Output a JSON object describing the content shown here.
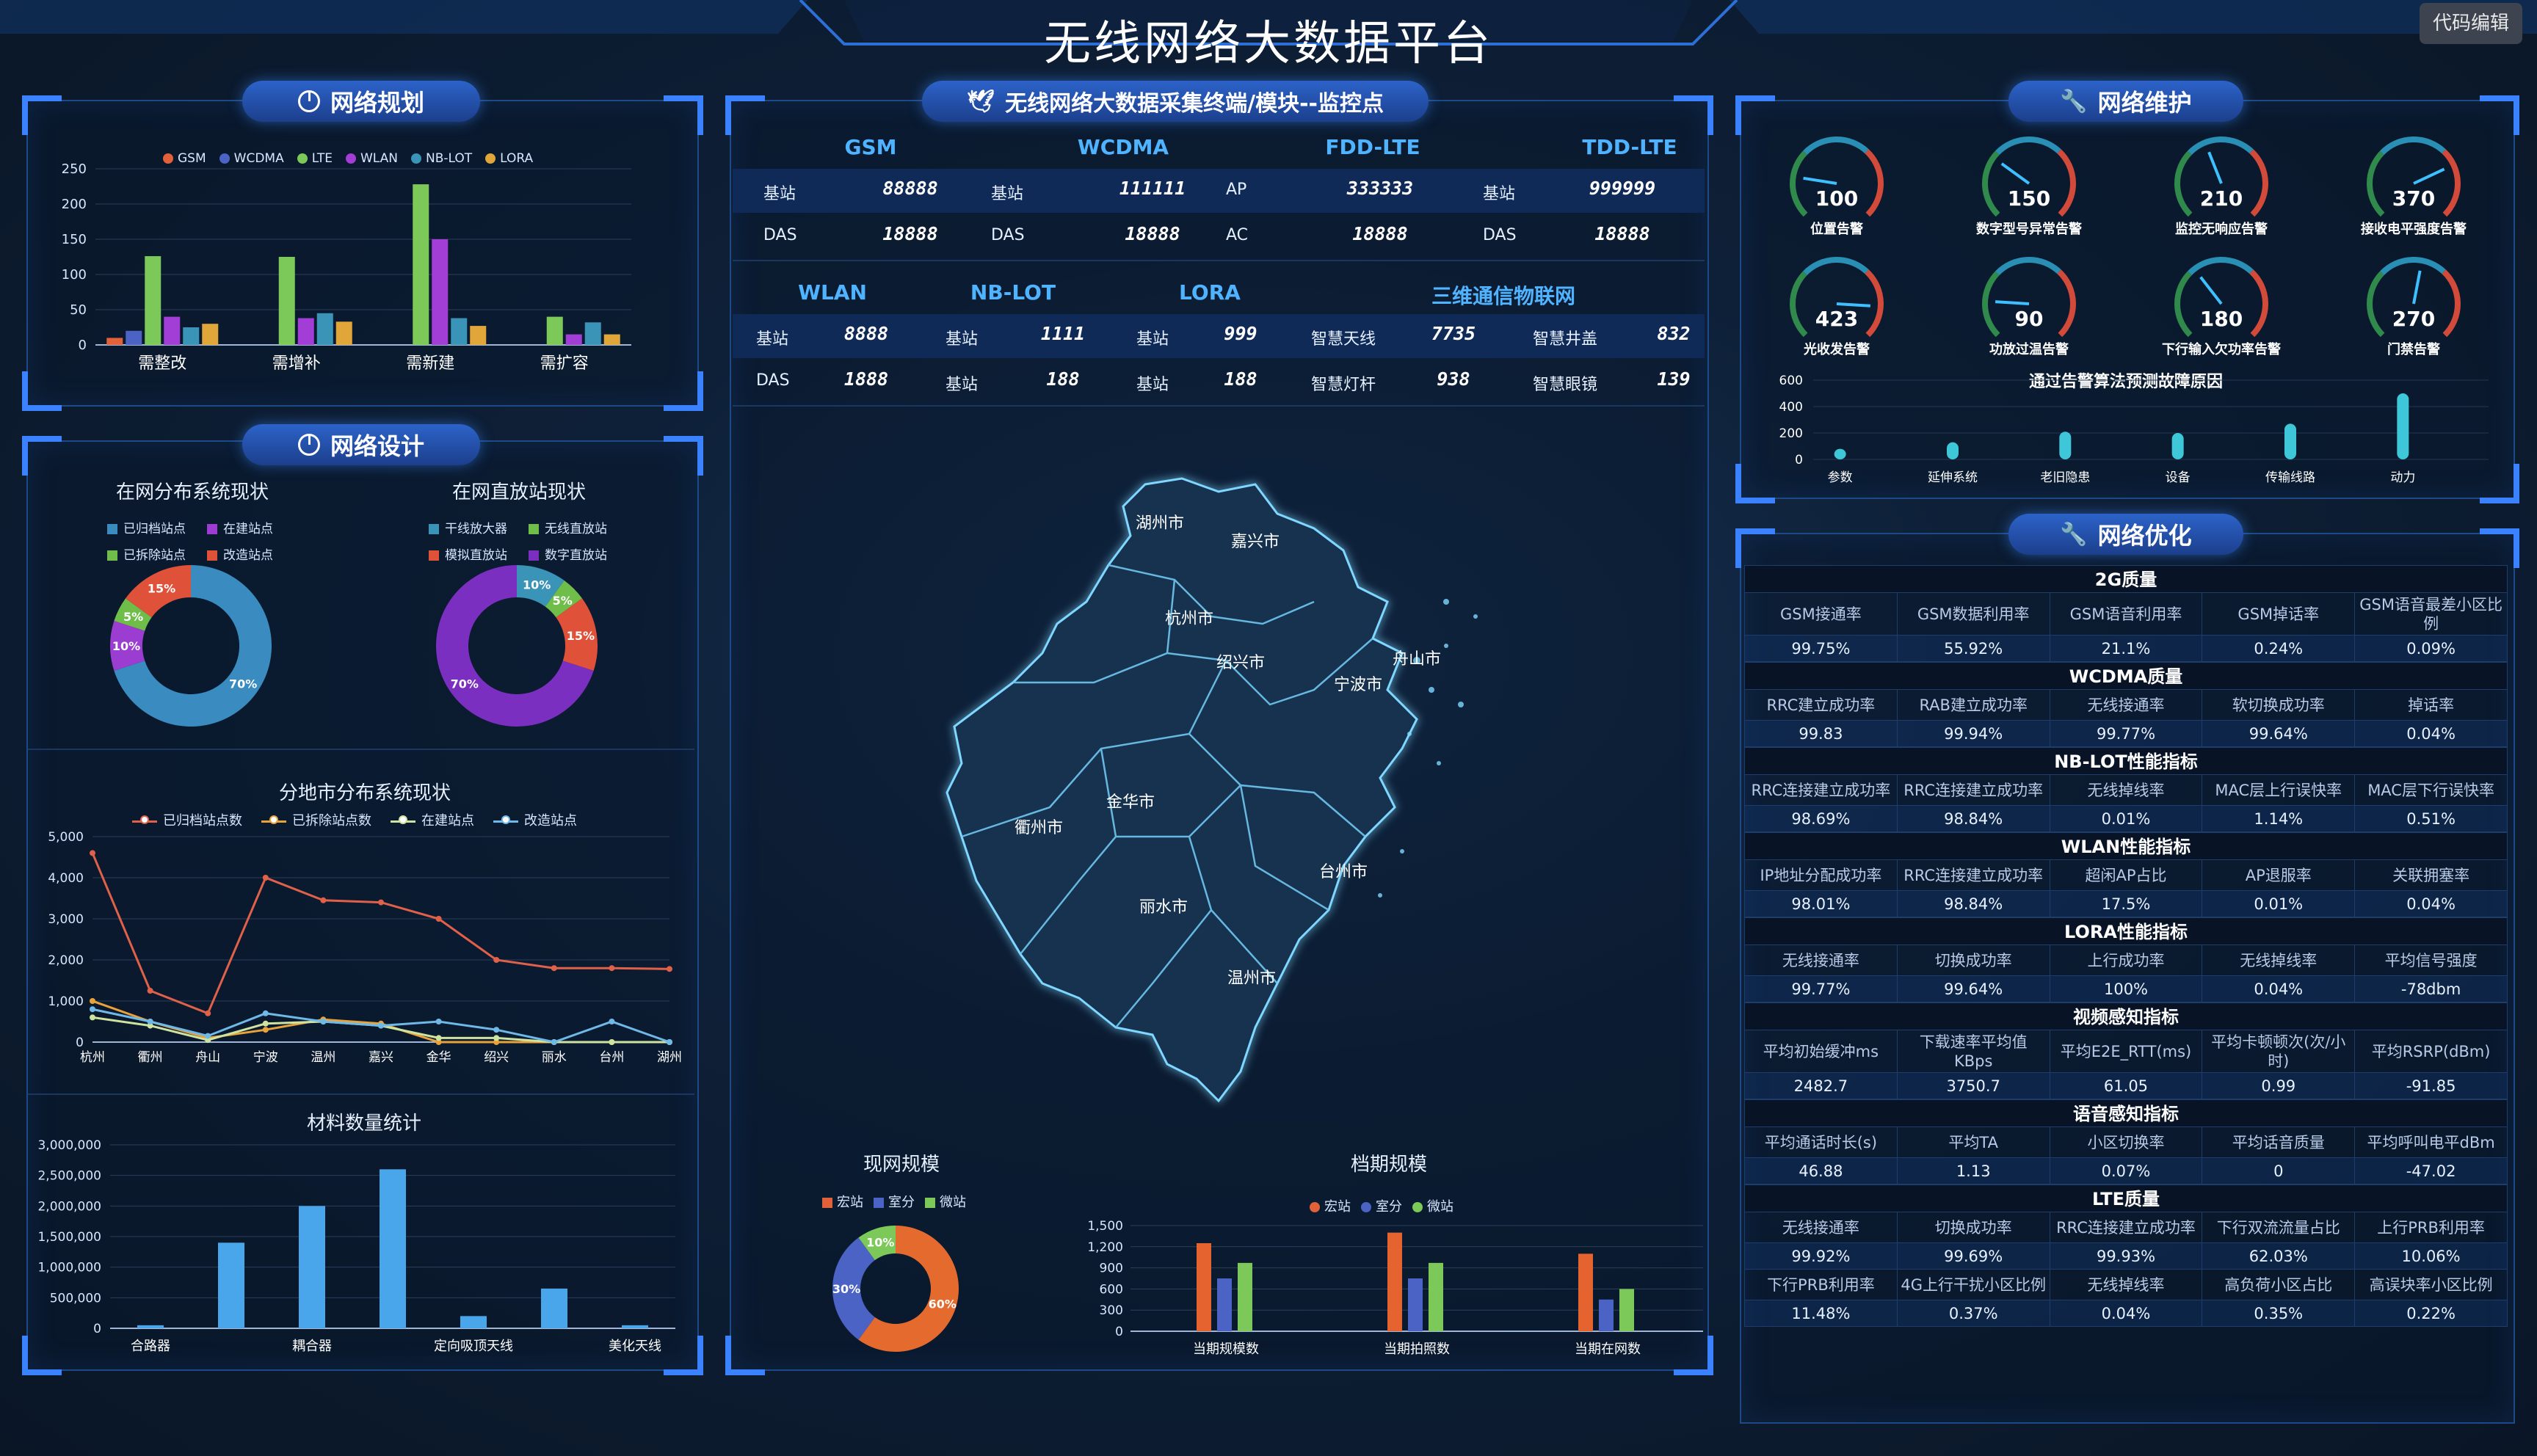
{
  "header": {
    "title": "无线网络大数据平台",
    "code_edit_button": "代码编辑"
  },
  "colors": {
    "gsm": "#e0613a",
    "wcdma": "#4a63c4",
    "lte": "#7cc95a",
    "wlan": "#a23dd6",
    "nblot": "#3a94b8",
    "lora": "#e0a63a"
  },
  "left": {
    "planning": {
      "title": "网络规划",
      "chart_data": {
        "type": "bar",
        "categories": [
          "需整改",
          "需增补",
          "需新建",
          "需扩容"
        ],
        "series": [
          {
            "name": "GSM",
            "values": [
              10,
              0,
              0,
              0
            ]
          },
          {
            "name": "WCDMA",
            "values": [
              20,
              0,
              0,
              0
            ]
          },
          {
            "name": "LTE",
            "values": [
              126,
              125,
              228,
              40
            ]
          },
          {
            "name": "WLAN",
            "values": [
              40,
              38,
              150,
              15
            ]
          },
          {
            "name": "NB-LOT",
            "values": [
              25,
              45,
              38,
              32
            ]
          },
          {
            "name": "LORA",
            "values": [
              30,
              33,
              27,
              15
            ]
          }
        ],
        "ylim": [
          0,
          250
        ],
        "yticks": [
          "0",
          "50",
          "100",
          "150",
          "200",
          "250"
        ]
      }
    },
    "design": {
      "title": "网络设计",
      "donut1": {
        "title": "在网分布系统现状",
        "legend": [
          "已归档站点",
          "在建站点",
          "已拆除站点",
          "改造站点"
        ],
        "chart_data": {
          "type": "pie",
          "labels": [
            "已归档站点",
            "在建站点",
            "已拆除站点",
            "改造站点"
          ],
          "values": [
            70,
            10,
            5,
            15
          ],
          "value_labels": [
            "70%",
            "10%",
            "5%",
            "15%"
          ]
        }
      },
      "donut2": {
        "title": "在网直放站现状",
        "legend": [
          "干线放大器",
          "无线直放站",
          "模拟直放站",
          "数字直放站"
        ],
        "chart_data": {
          "type": "pie",
          "labels": [
            "干线放大器",
            "无线直放站",
            "模拟直放站",
            "数字直放站"
          ],
          "values": [
            10,
            5,
            15,
            70
          ],
          "value_labels": [
            "10%",
            "5%",
            "15%",
            "70%"
          ]
        }
      },
      "line": {
        "title": "分地市分布系统现状",
        "chart_data": {
          "type": "line",
          "categories": [
            "杭州",
            "衢州",
            "舟山",
            "宁波",
            "温州",
            "嘉兴",
            "金华",
            "绍兴",
            "丽水",
            "台州",
            "湖州"
          ],
          "series": [
            {
              "name": "已归档站点数",
              "values": [
                4600,
                1250,
                700,
                4000,
                3450,
                3400,
                3000,
                2000,
                1800,
                1800,
                1780
              ]
            },
            {
              "name": "已拆除站点数",
              "values": [
                1000,
                500,
                100,
                300,
                550,
                450,
                0,
                0,
                0,
                0,
                0
              ]
            },
            {
              "name": "在建站点",
              "values": [
                600,
                400,
                50,
                450,
                500,
                400,
                100,
                100,
                0,
                0,
                0
              ]
            },
            {
              "name": "改造站点",
              "values": [
                800,
                500,
                150,
                700,
                500,
                400,
                500,
                300,
                0,
                500,
                0
              ]
            }
          ],
          "ylim": [
            0,
            5000
          ],
          "yticks": [
            "0",
            "1,000",
            "2,000",
            "3,000",
            "4,000",
            "5,000"
          ],
          "colors": [
            "#e0614a",
            "#e9a23a",
            "#cfe3a0",
            "#6fb9e8"
          ]
        }
      },
      "materials": {
        "title": "材料数量统计",
        "chart_data": {
          "type": "bar",
          "categories": [
            "合路器",
            "耦合器",
            "定向吸顶天线",
            "美化天线"
          ],
          "x_labels_shown": [
            "合路器",
            "耦合器",
            "定向吸顶天线",
            "美化天线"
          ],
          "values": [
            50000,
            1400000,
            2000000,
            2600000,
            200000,
            650000,
            50000
          ],
          "ylim": [
            0,
            3000000
          ],
          "yticks": [
            "0",
            "500,000",
            "1,000,000",
            "1,500,000",
            "2,000,000",
            "2,500,000",
            "3,000,000"
          ]
        }
      }
    }
  },
  "center": {
    "title": "无线网络大数据采集终端/模块--监控点",
    "row_headers_1": [
      "GSM",
      "WCDMA",
      "FDD-LTE",
      "TDD-LTE"
    ],
    "row1": [
      [
        "基站",
        "88888"
      ],
      [
        "基站",
        "111111"
      ],
      [
        "AP",
        "333333"
      ],
      [
        "基站",
        "999999"
      ]
    ],
    "row2": [
      [
        "DAS",
        "18888"
      ],
      [
        "DAS",
        "18888"
      ],
      [
        "AC",
        "18888"
      ],
      [
        "DAS",
        "18888"
      ]
    ],
    "row_headers_2": [
      "WLAN",
      "NB-LOT",
      "LORA",
      "三维通信物联网"
    ],
    "row3": [
      [
        "基站",
        "8888"
      ],
      [
        "基站",
        "1111"
      ],
      [
        "基站",
        "999"
      ],
      [
        "智慧天线",
        "7735"
      ],
      [
        "智慧井盖",
        "832"
      ]
    ],
    "row4": [
      [
        "DAS",
        "1888"
      ],
      [
        "基站",
        "188"
      ],
      [
        "基站",
        "188"
      ],
      [
        "智慧灯杆",
        "938"
      ],
      [
        "智慧眼镜",
        "139"
      ]
    ],
    "map_cities": [
      "湖州市",
      "嘉兴市",
      "杭州市",
      "绍兴市",
      "宁波市",
      "舟山市",
      "金华市",
      "衢州市",
      "台州市",
      "丽水市",
      "温州市"
    ],
    "current_scale": {
      "title": "现网规模",
      "legend": [
        "宏站",
        "室分",
        "微站"
      ],
      "chart_data": {
        "type": "pie",
        "labels": [
          "宏站",
          "室分",
          "微站"
        ],
        "values": [
          60,
          30,
          10
        ],
        "value_labels": [
          "60%",
          "30%",
          "10%"
        ]
      }
    },
    "period_scale": {
      "title": "档期规模",
      "legend": [
        "宏站",
        "室分",
        "微站"
      ],
      "chart_data": {
        "type": "bar",
        "categories": [
          "当期规模数",
          "当期拍照数",
          "当期在网数"
        ],
        "series": [
          {
            "name": "宏站",
            "values": [
              1250,
              1400,
              1100
            ]
          },
          {
            "name": "室分",
            "values": [
              750,
              750,
              450
            ]
          },
          {
            "name": "微站",
            "values": [
              970,
              970,
              600
            ]
          }
        ],
        "ylim": [
          0,
          1500
        ],
        "yticks": [
          "0",
          "300",
          "600",
          "900",
          "1,200",
          "1,500"
        ]
      }
    }
  },
  "right": {
    "maintenance": {
      "title": "网络维护",
      "gauges": [
        {
          "value": "100",
          "label": "位置告警"
        },
        {
          "value": "150",
          "label": "数字型号异常告警"
        },
        {
          "value": "210",
          "label": "监控无响应告警"
        },
        {
          "value": "370",
          "label": "接收电平强度告警"
        },
        {
          "value": "423",
          "label": "光收发告警"
        },
        {
          "value": "90",
          "label": "功放过温告警"
        },
        {
          "value": "180",
          "label": "下行输入欠功率告警"
        },
        {
          "value": "270",
          "label": "门禁告警"
        }
      ],
      "fault_chart": {
        "title": "通过告警算法预测故障原因",
        "chart_data": {
          "type": "bar",
          "categories": [
            "参数",
            "延伸系统",
            "老旧隐患",
            "设备",
            "传输线路",
            "动力"
          ],
          "values": [
            80,
            130,
            210,
            200,
            270,
            500
          ],
          "ylim": [
            0,
            600
          ],
          "yticks": [
            "0",
            "200",
            "400",
            "600"
          ]
        }
      }
    },
    "optimization": {
      "title": "网络优化",
      "sections": [
        {
          "name": "2G质量",
          "headers": [
            "GSM接通率",
            "GSM数据利用率",
            "GSM语音利用率",
            "GSM掉话率",
            "GSM语音最差小区比例"
          ],
          "values": [
            "99.75%",
            "55.92%",
            "21.1%",
            "0.24%",
            "0.09%"
          ]
        },
        {
          "name": "WCDMA质量",
          "headers": [
            "RRC建立成功率",
            "RAB建立成功率",
            "无线接通率",
            "软切换成功率",
            "掉话率"
          ],
          "values": [
            "99.83",
            "99.94%",
            "99.77%",
            "99.64%",
            "0.04%"
          ]
        },
        {
          "name": "NB-LOT性能指标",
          "headers": [
            "RRC连接建立成功率",
            "RRC连接建立成功率",
            "无线掉线率",
            "MAC层上行误快率",
            "MAC层下行误快率"
          ],
          "values": [
            "98.69%",
            "98.84%",
            "0.01%",
            "1.14%",
            "0.51%"
          ]
        },
        {
          "name": "WLAN性能指标",
          "headers": [
            "IP地址分配成功率",
            "RRC连接建立成功率",
            "超闲AP占比",
            "AP退服率",
            "关联拥塞率"
          ],
          "values": [
            "98.01%",
            "98.84%",
            "17.5%",
            "0.01%",
            "0.04%"
          ]
        },
        {
          "name": "LORA性能指标",
          "headers": [
            "无线接通率",
            "切换成功率",
            "上行成功率",
            "无线掉线率",
            "平均信号强度"
          ],
          "values": [
            "99.77%",
            "99.64%",
            "100%",
            "0.04%",
            "-78dbm"
          ]
        },
        {
          "name": "视频感知指标",
          "headers": [
            "平均初始缓冲ms",
            "下载速率平均值KBps",
            "平均E2E_RTT(ms)",
            "平均卡顿顿次(次/小时)",
            "平均RSRP(dBm)"
          ],
          "values": [
            "2482.7",
            "3750.7",
            "61.05",
            "0.99",
            "-91.85"
          ]
        },
        {
          "name": "语音感知指标",
          "headers": [
            "平均通话时长(s)",
            "平均TA",
            "小区切换率",
            "平均话音质量",
            "平均呼叫电平dBm"
          ],
          "values": [
            "46.88",
            "1.13",
            "0.07%",
            "0",
            "-47.02"
          ]
        },
        {
          "name": "LTE质量",
          "headers": [
            "无线接通率",
            "切换成功率",
            "RRC连接建立成功率",
            "下行双流流量占比",
            "上行PRB利用率"
          ],
          "values": [
            "99.92%",
            "99.69%",
            "99.93%",
            "62.03%",
            "10.06%"
          ]
        },
        {
          "name": "",
          "headers": [
            "下行PRB利用率",
            "4G上行干扰小区比例",
            "无线掉线率",
            "高负荷小区占比",
            "高误块率小区比例"
          ],
          "values": [
            "11.48%",
            "0.37%",
            "0.04%",
            "0.35%",
            "0.22%"
          ]
        }
      ]
    }
  }
}
